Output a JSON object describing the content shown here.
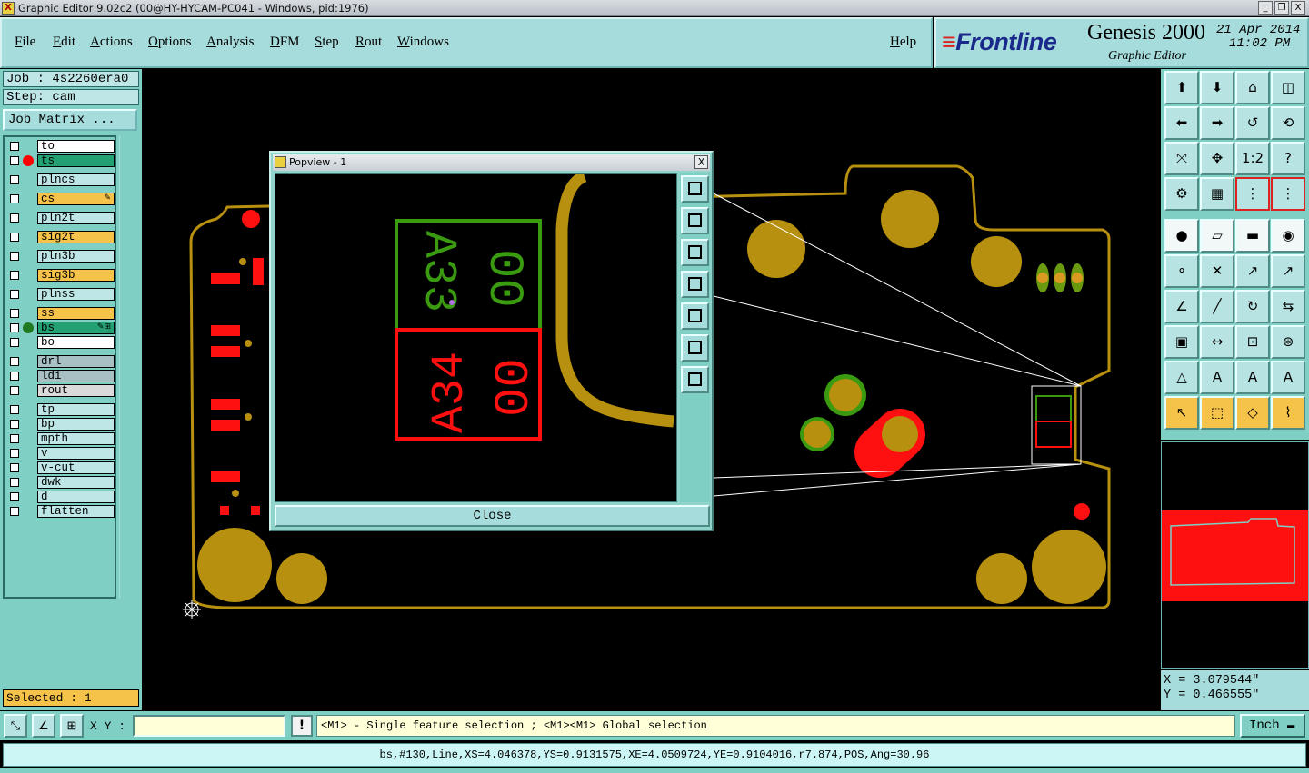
{
  "window": {
    "title": "Graphic Editor 9.02c2 (00@HY-HYCAM-PC041 - Windows, pid:1976)",
    "controls": [
      "_",
      "❐",
      "X"
    ]
  },
  "menu": [
    "File",
    "Edit",
    "Actions",
    "Options",
    "Analysis",
    "DFM",
    "Step",
    "Rout",
    "Windows"
  ],
  "help_label": "Help",
  "brand": {
    "logo": "Frontline",
    "product": "Genesis 2000",
    "subtitle": "Graphic Editor",
    "date": "21 Apr 2014",
    "time": "11:02 PM"
  },
  "job": {
    "job_label": "Job : 4s2260era0",
    "step_label": "Step: cam",
    "matrix_button": "Job Matrix ..."
  },
  "layers": [
    {
      "name": "to",
      "color": "#ffffff"
    },
    {
      "name": "ts",
      "color": "#23a074",
      "marker": "#ff0000"
    },
    {
      "name": "plncs",
      "color": "#bfe6e6"
    },
    {
      "name": "cs",
      "color": "#f5c24a",
      "flag": "✎"
    },
    {
      "name": "pln2t",
      "color": "#bfe6e6"
    },
    {
      "name": "sig2t",
      "color": "#f5c24a"
    },
    {
      "name": "pln3b",
      "color": "#bfe6e6"
    },
    {
      "name": "sig3b",
      "color": "#f5c24a"
    },
    {
      "name": "plnss",
      "color": "#bfe6e6"
    },
    {
      "name": "ss",
      "color": "#f5c24a"
    },
    {
      "name": "bs",
      "color": "#23a074",
      "marker": "#1f7a20",
      "flag": "✎⊞"
    },
    {
      "name": "bo",
      "color": "#ffffff"
    },
    {
      "name": "drl",
      "color": "#a8c0c4"
    },
    {
      "name": "ldi",
      "color": "#a8c0c4"
    },
    {
      "name": "rout",
      "color": "#dadada"
    },
    {
      "name": "tp",
      "color": "#bfe6e6"
    },
    {
      "name": "bp",
      "color": "#bfe6e6"
    },
    {
      "name": "mpth",
      "color": "#bfe6e6"
    },
    {
      "name": "v",
      "color": "#bfe6e6"
    },
    {
      "name": "v-cut",
      "color": "#bfe6e6"
    },
    {
      "name": "dwk",
      "color": "#bfe6e6"
    },
    {
      "name": "d",
      "color": "#bfe6e6"
    },
    {
      "name": "flatten",
      "color": "#bfe6e6"
    }
  ],
  "selected_label": "Selected : 1",
  "popview": {
    "title": "Popview - 1",
    "close_x": "X",
    "close_button": "Close",
    "green_text_1": "A33",
    "green_text_2": "00",
    "red_text_1": "A34",
    "red_text_2": "00"
  },
  "right_tools": {
    "ratio_label": "1:2",
    "help_label": "?"
  },
  "coords": {
    "x": "X = 3.079544\"",
    "y": "Y = 0.466555\""
  },
  "cmd": {
    "xy_label": "X Y :",
    "xy_value": "",
    "excl": "!",
    "hint": "<M1> - Single feature selection ; <M1><M1> Global selection",
    "units": "Inch"
  },
  "status": "bs,#130,Line,XS=4.046378,YS=0.9131575,XE=4.0509724,YE=0.9104016,r7.874,POS,Ang=30.96",
  "colors": {
    "copper": "#b8900f",
    "top_silk": "#ff1010",
    "bottom_silk": "#3a9a10",
    "panel": "#7fcfc4",
    "button": "#a6dcdc",
    "highlight": "#f5c24a"
  }
}
